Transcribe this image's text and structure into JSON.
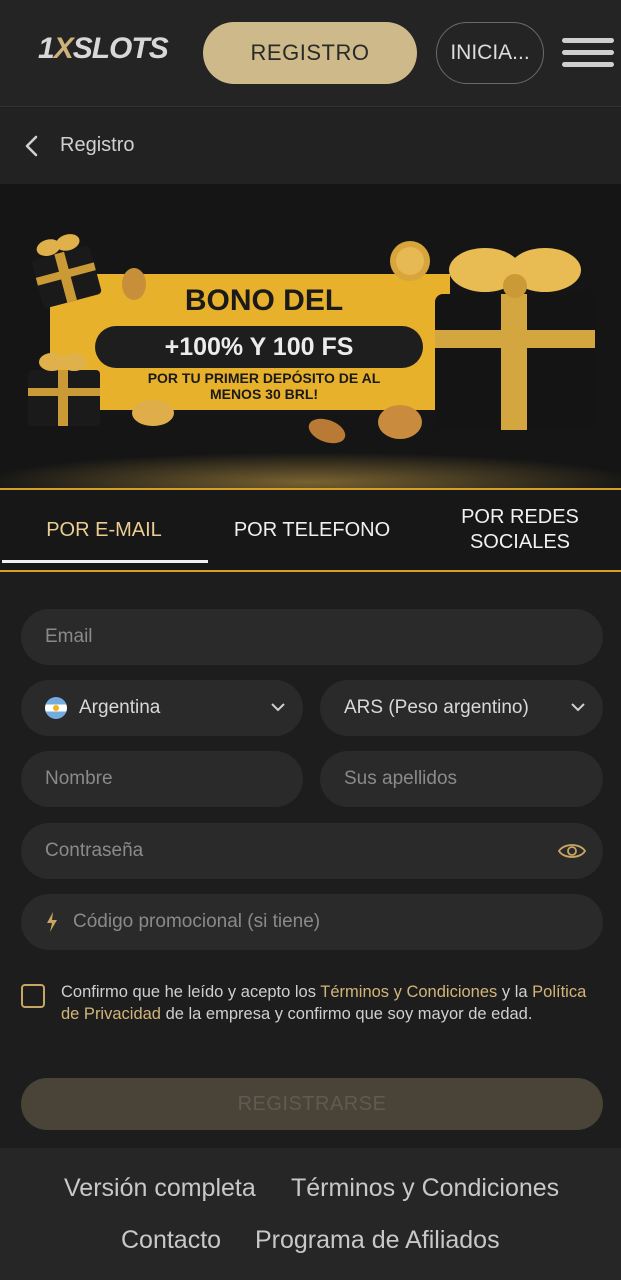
{
  "header": {
    "logo_prefix": "1",
    "logo_x": "X",
    "logo_suffix": "SLOTS",
    "register_label": "REGISTRO",
    "login_label": "INICIA..."
  },
  "subheader": {
    "title": "Registro"
  },
  "banner": {
    "title": "BONO DEL",
    "highlight": "+100% Y 100 FS",
    "subtitle": "POR TU PRIMER DEPÓSITO DE AL MENOS 30 BRL!"
  },
  "tabs": [
    {
      "label": "POR E-MAIL"
    },
    {
      "label": "POR TELEFONO"
    },
    {
      "label": "POR REDES SOCIALES"
    }
  ],
  "form": {
    "email_placeholder": "Email",
    "country_value": "Argentina",
    "currency_value": "ARS (Peso argentino)",
    "first_name_placeholder": "Nombre",
    "last_name_placeholder": "Sus apellidos",
    "password_placeholder": "Contraseña",
    "promo_placeholder": "Código promocional (si tiene)",
    "consent_part1": "Confirmo que he leído y acepto los ",
    "consent_terms_link": "Términos y Condiciones",
    "consent_part2": " y la ",
    "consent_privacy_link": "Política de Privacidad",
    "consent_part3": " de la empresa y confirmo que soy mayor de edad.",
    "submit_label": "REGISTRARSE"
  },
  "footer": {
    "links": [
      "Versión completa",
      "Términos y Condiciones",
      "Contacto",
      "Programa de Afiliados"
    ]
  },
  "colors": {
    "accent_gold": "#cdb98a",
    "banner_yellow": "#e7b12b",
    "background": "#1c1c1c"
  }
}
